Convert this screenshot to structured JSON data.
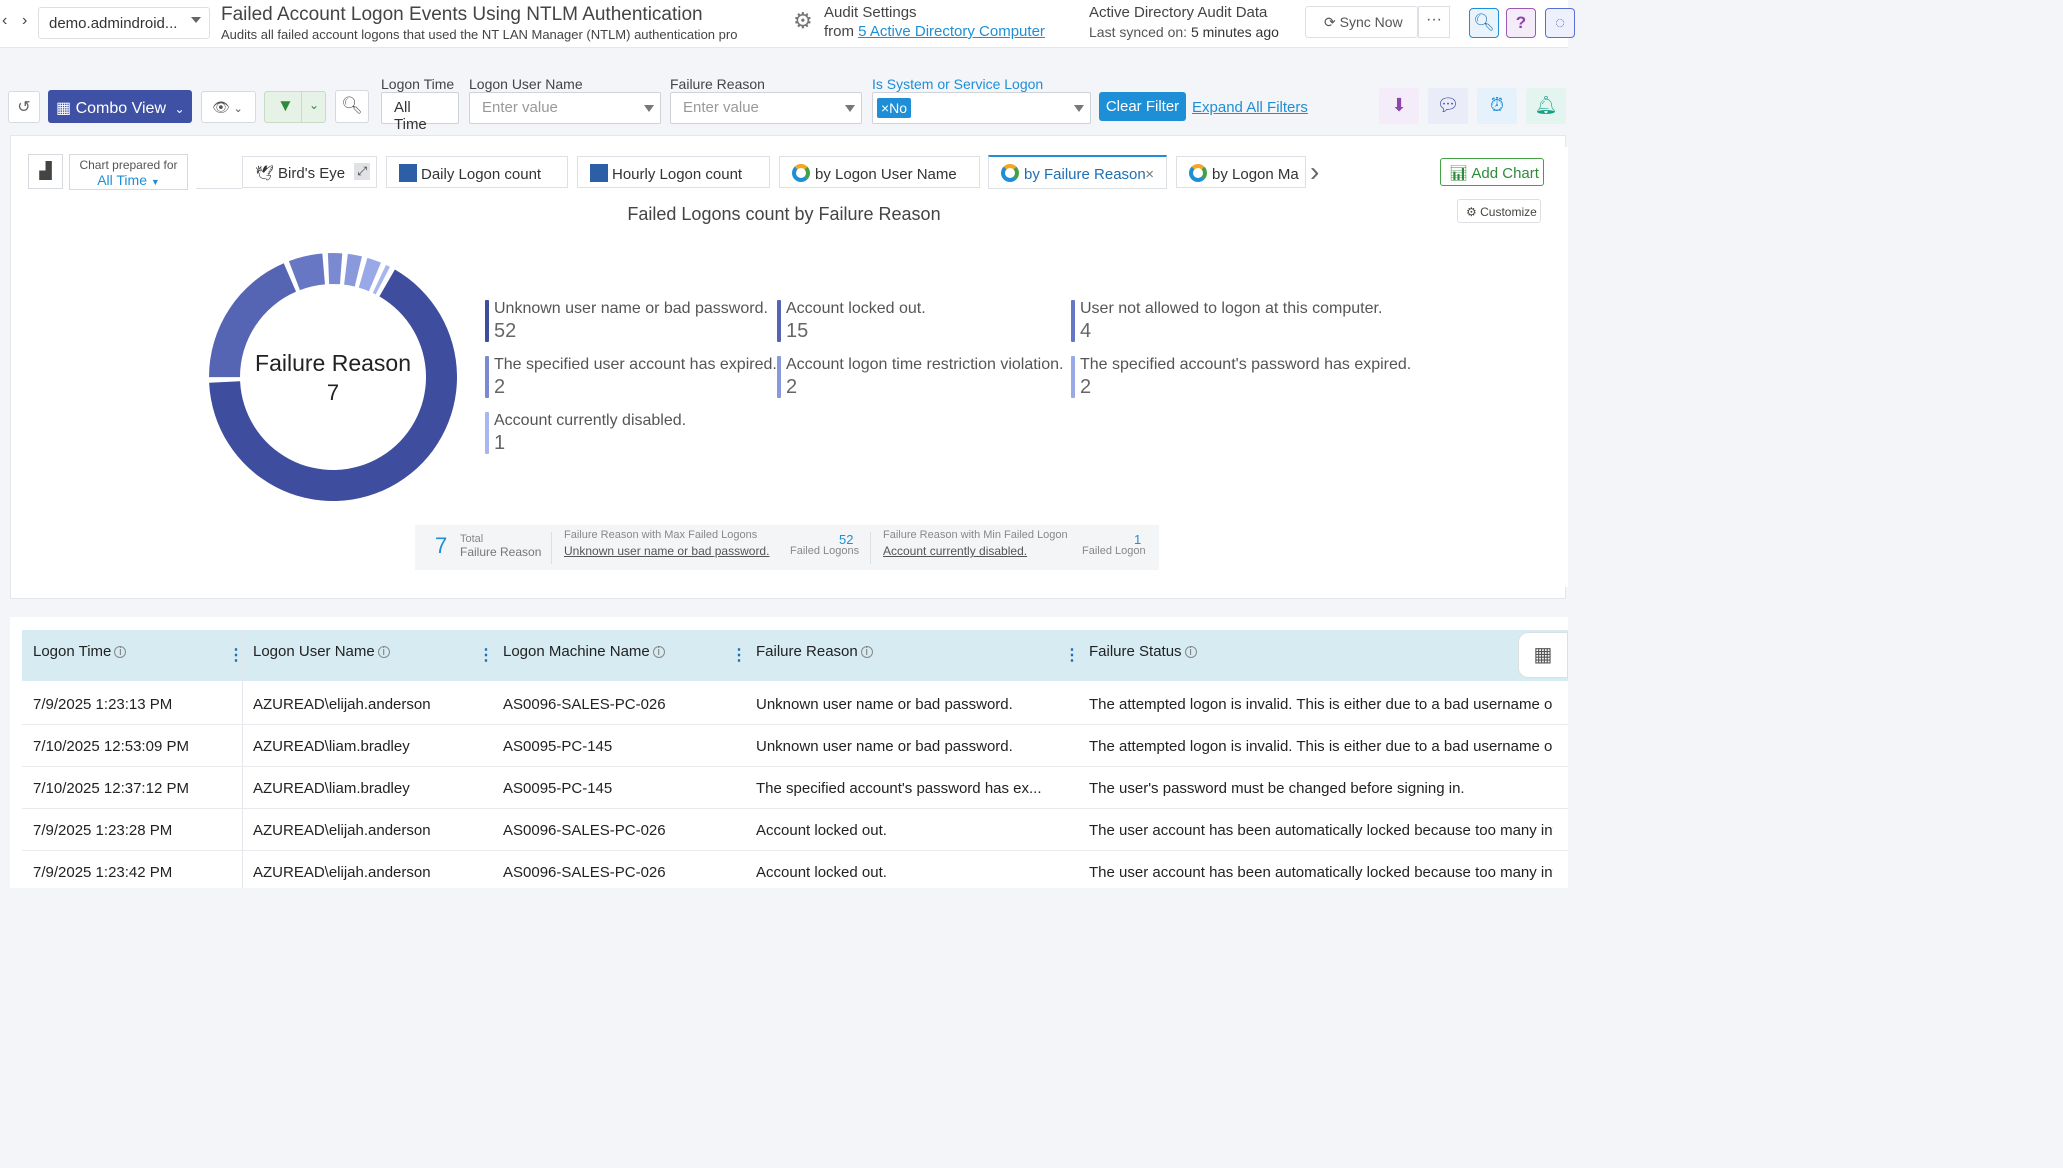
{
  "header": {
    "domain": "demo.admindroid...",
    "title": "Failed Account Logon Events Using NTLM Authentication",
    "subtitle": "Audits all failed account logons that used the NT LAN Manager (NTLM) authentication pro",
    "audit_settings_label": "Audit Settings",
    "audit_from": "from",
    "audit_link": "5 Active Directory Computer",
    "ad_title": "Active Directory Audit Data",
    "ad_synced_label": "Last synced on:",
    "ad_synced_value": "5 minutes ago",
    "sync_button": "Sync Now",
    "more": "···"
  },
  "toolbar": {
    "combo_view": "Combo View",
    "filters": [
      {
        "label": "Logon Time",
        "value": "All Time"
      },
      {
        "label": "Logon User Name",
        "placeholder": "Enter value"
      },
      {
        "label": "Failure Reason",
        "placeholder": "Enter value"
      },
      {
        "label": "Is System or Service Logon",
        "tag": "×No"
      }
    ],
    "clear_filter": "Clear Filter",
    "expand_filters": "Expand All Filters"
  },
  "chart_panel": {
    "prepared_label": "Chart prepared for",
    "prepared_value": "All Time",
    "tabs": [
      "Bird's Eye",
      "Daily Logon count",
      "Hourly Logon count",
      "by Logon User Name",
      "by Failure Reason",
      "by Logon Ma"
    ],
    "active_tab_close": "×",
    "add_chart": "Add Chart",
    "customize": "Customize"
  },
  "chart_data": {
    "type": "pie",
    "title": "Failed Logons count by Failure Reason",
    "center_label": "Failure Reason",
    "center_value": "7",
    "categories": [
      "Unknown user name or bad password.",
      "Account locked out.",
      "User not allowed to logon at this computer.",
      "The specified user account has expired.",
      "Account logon time restriction violation.",
      "The specified account's password has expired.",
      "Account currently disabled."
    ],
    "values": [
      52,
      15,
      4,
      2,
      2,
      2,
      1
    ],
    "colors": [
      "#3e4d9e",
      "#5565b4",
      "#6777c3",
      "#7b8ad0",
      "#8a99dc",
      "#99a8e6",
      "#a8b6ef"
    ]
  },
  "summary": {
    "total_value": "7",
    "total_label1": "Total",
    "total_label2": "Failure Reason",
    "max_label": "Failure Reason with Max Failed Logons",
    "max_link": "Unknown user name or bad password.",
    "max_value": "52",
    "max_unit": "Failed Logons",
    "min_label": "Failure Reason with Min Failed Logon",
    "min_link": "Account currently disabled.",
    "min_value": "1",
    "min_unit": "Failed Logon"
  },
  "table": {
    "columns": [
      "Logon Time",
      "Logon User Name",
      "Logon Machine Name",
      "Failure Reason",
      "Failure Status"
    ],
    "rows": [
      [
        "7/9/2025 1:23:13 PM",
        "AZUREAD\\elijah.anderson",
        "AS0096-SALES-PC-026",
        "Unknown user name or bad password.",
        "The attempted logon is invalid. This is either due to a bad username or authentication information."
      ],
      [
        "7/10/2025 12:53:09 PM",
        "AZUREAD\\liam.bradley",
        "AS0095-PC-145",
        "Unknown user name or bad password.",
        "The attempted logon is invalid. This is either due to a bad username or authentication information."
      ],
      [
        "7/10/2025 12:37:12 PM",
        "AZUREAD\\liam.bradley",
        "AS0095-PC-145",
        "The specified account's password has ex...",
        "The user's password must be changed before signing in."
      ],
      [
        "7/9/2025 1:23:28 PM",
        "AZUREAD\\elijah.anderson",
        "AS0096-SALES-PC-026",
        "Account locked out.",
        "The user account has been automatically locked because too many invalid logon attempts"
      ],
      [
        "7/9/2025 1:23:42 PM",
        "AZUREAD\\elijah.anderson",
        "AS0096-SALES-PC-026",
        "Account locked out.",
        "The user account has been automatically locked because too many invalid logon attempts"
      ]
    ]
  }
}
